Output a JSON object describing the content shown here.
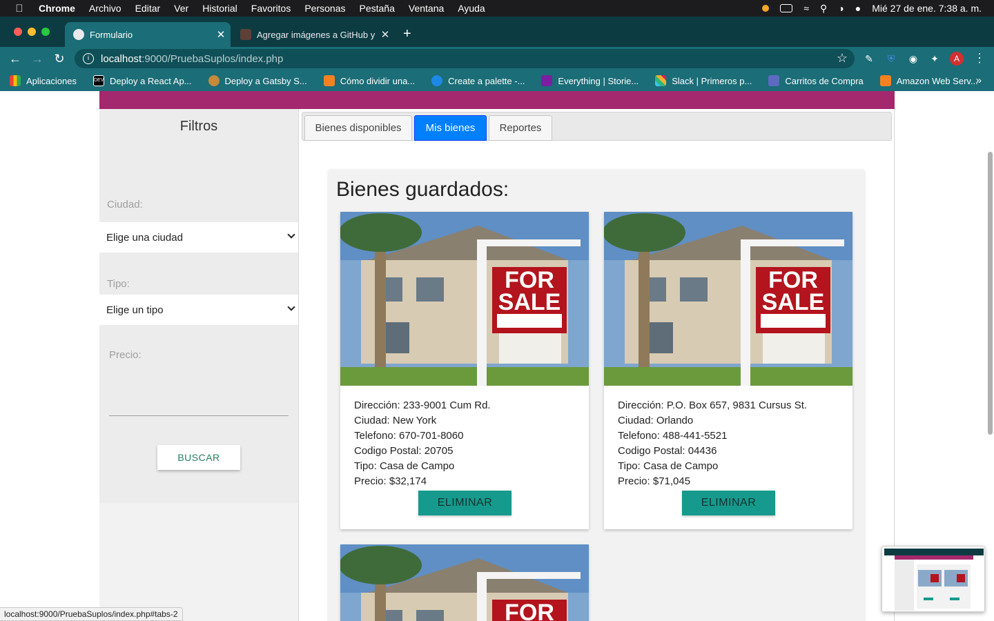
{
  "menubar": {
    "app": "Chrome",
    "menus": [
      "Archivo",
      "Editar",
      "Ver",
      "Historial",
      "Favoritos",
      "Personas",
      "Pestaña",
      "Ventana",
      "Ayuda"
    ],
    "datetime": "Mié 27 de ene.  7:38 a. m."
  },
  "browser": {
    "tabs": [
      {
        "title": "Formulario",
        "active": true
      },
      {
        "title": "Agregar imágenes a GitHub y p",
        "active": false
      }
    ],
    "url_host": "localhost",
    "url_path": ":9000/PruebaSuplos/index.php",
    "profile_initial": "A",
    "bookmarks": [
      {
        "label": "Aplicaciones",
        "icon": "apps-grid-icon",
        "color": "#4285f4"
      },
      {
        "label": "Deploy a React Ap...",
        "icon": "dev-icon",
        "color": "#000000"
      },
      {
        "label": "Deploy a Gatsby S...",
        "icon": "dog-icon",
        "color": "#c58a3a"
      },
      {
        "label": "Cómo dividir una...",
        "icon": "cube-icon",
        "color": "#f58220"
      },
      {
        "label": "Create a palette -...",
        "icon": "circle-c-icon",
        "color": "#1e88e5"
      },
      {
        "label": "Everything | Storie...",
        "icon": "storybook-icon",
        "color": "#7b1fa2"
      },
      {
        "label": "Slack | Primeros p...",
        "icon": "slack-icon",
        "color": "#36c5f0"
      },
      {
        "label": "Carritos de Compra",
        "icon": "m-logo-icon",
        "color": "#5c6bc0"
      },
      {
        "label": "Amazon Web Serv...",
        "icon": "cube-icon",
        "color": "#f58220"
      }
    ],
    "status_url": "localhost:9000/PruebaSuplos/index.php#tabs-2"
  },
  "sidebar": {
    "title": "Filtros",
    "ciudad_label": "Ciudad:",
    "ciudad_value": "Elige una ciudad",
    "tipo_label": "Tipo:",
    "tipo_value": "Elige un tipo",
    "precio_label": "Precio:",
    "buscar_label": "BUSCAR"
  },
  "page_tabs": [
    {
      "label": "Bienes disponibles",
      "selected": false
    },
    {
      "label": "Mis bienes",
      "selected": true
    },
    {
      "label": "Reportes",
      "selected": false
    }
  ],
  "panel": {
    "title": "Bienes guardados:",
    "sign_text": [
      "FOR",
      "SALE"
    ],
    "cards": [
      {
        "direccion": "Dirección: 233-9001 Cum Rd.",
        "ciudad": "Ciudad: New York",
        "telefono": "Telefono: 670-701-8060",
        "codigo_postal": "Codigo Postal: 20705",
        "tipo": "Tipo: Casa de Campo",
        "precio": "Precio: $32,174",
        "button": "ELIMINAR"
      },
      {
        "direccion": "Dirección: P.O. Box 657, 9831 Cursus St.",
        "ciudad": "Ciudad: Orlando",
        "telefono": "Telefono: 488-441-5521",
        "codigo_postal": "Codigo Postal: 04436",
        "tipo": "Tipo: Casa de Campo",
        "precio": "Precio: $71,045",
        "button": "ELIMINAR"
      }
    ]
  },
  "colors": {
    "topband": "#a3286e",
    "tab_selected": "#007fff",
    "eliminar": "#159a8d",
    "chrome_frame": "#0d3b42"
  }
}
